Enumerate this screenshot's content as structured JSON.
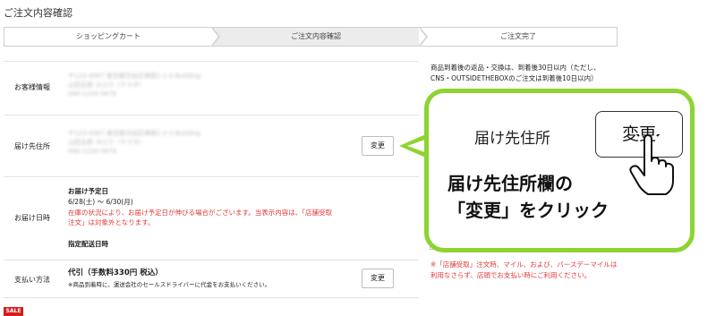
{
  "page": {
    "title": "ご注文内容確認"
  },
  "steps": [
    "ショッピングカート",
    "ご注文内容確認",
    "ご注文完了"
  ],
  "sections": {
    "customer": {
      "label": "お客様情報"
    },
    "shipping": {
      "label": "届け先住所",
      "button": "変更"
    },
    "delivery": {
      "label": "お届け日時",
      "heading": "お届け予定日",
      "dates": "6/28(土) 〜 6/30(月)",
      "notice": "在庫の状況により、お届け予定日が伸びる場合がございます。当表示内容は、「店舗受取注文」は対象外となります。",
      "specified": "指定配送日時"
    },
    "payment": {
      "label": "支払い方法",
      "method": "代引（手数料330円 税込）",
      "note": "※商品到着時に、運送会社のセールスドライバーに代金をお支払いください。",
      "button": "変更"
    }
  },
  "right_panel": {
    "note": "商品到着後の返品・交換は、到着後30日以内（ただし、CNS・OUTSIDETHEBOXのご注文は到着後10日以内）",
    "store_note": "※「店舗受取」注文時、マイル、および、バースデーマイルは利用なさらず、店頭でお支払い時にご利用ください。"
  },
  "sale_badge": "SALE",
  "callout": {
    "label": "届け先住所",
    "button": "変更",
    "instruction_line1": "届け先住所欄の",
    "instruction_line2": "「変更」をクリック"
  },
  "colors": {
    "accent_green": "#8dd331",
    "notice_red": "#e03a3a",
    "sale_red": "#d91c1c"
  }
}
